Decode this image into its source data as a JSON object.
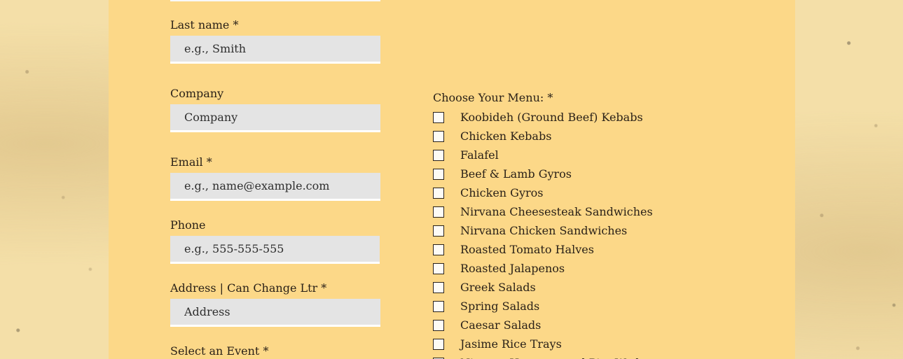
{
  "form": {
    "last_name": {
      "label": "Last name",
      "required_mark": "*",
      "placeholder": "e.g., Smith"
    },
    "company": {
      "label": "Company",
      "placeholder": "Company"
    },
    "email": {
      "label": "Email",
      "required_mark": "*",
      "placeholder": "e.g., name@example.com"
    },
    "phone": {
      "label": "Phone",
      "placeholder": "e.g., 555-555-555"
    },
    "address": {
      "label": "Address | Can Change Ltr",
      "required_mark": "*",
      "placeholder": "Address"
    },
    "event": {
      "label": "Select an Event",
      "required_mark": "*"
    }
  },
  "menu": {
    "label": "Choose Your Menu:",
    "required_mark": "*",
    "items": [
      {
        "label": "Koobideh (Ground Beef) Kebabs",
        "checked": false
      },
      {
        "label": "Chicken Kebabs",
        "checked": false
      },
      {
        "label": "Falafel",
        "checked": false
      },
      {
        "label": "Beef & Lamb Gyros",
        "checked": false
      },
      {
        "label": "Chicken Gyros",
        "checked": false
      },
      {
        "label": "Nirvana Cheesesteak Sandwiches",
        "checked": false
      },
      {
        "label": "Nirvana Chicken Sandwiches",
        "checked": false
      },
      {
        "label": "Roasted Tomato Halves",
        "checked": false
      },
      {
        "label": "Roasted Jalapenos",
        "checked": false
      },
      {
        "label": "Greek Salads",
        "checked": false
      },
      {
        "label": "Spring Salads",
        "checked": false
      },
      {
        "label": "Caesar Salads",
        "checked": false
      },
      {
        "label": "Jasime Rice Trays",
        "checked": false
      },
      {
        "label": "Nirvana Hummus and Pita Wedges",
        "checked": false
      }
    ]
  },
  "colors": {
    "panel": "#fcd888",
    "input_bg": "#e4e4e4",
    "text": "#2a2118"
  }
}
